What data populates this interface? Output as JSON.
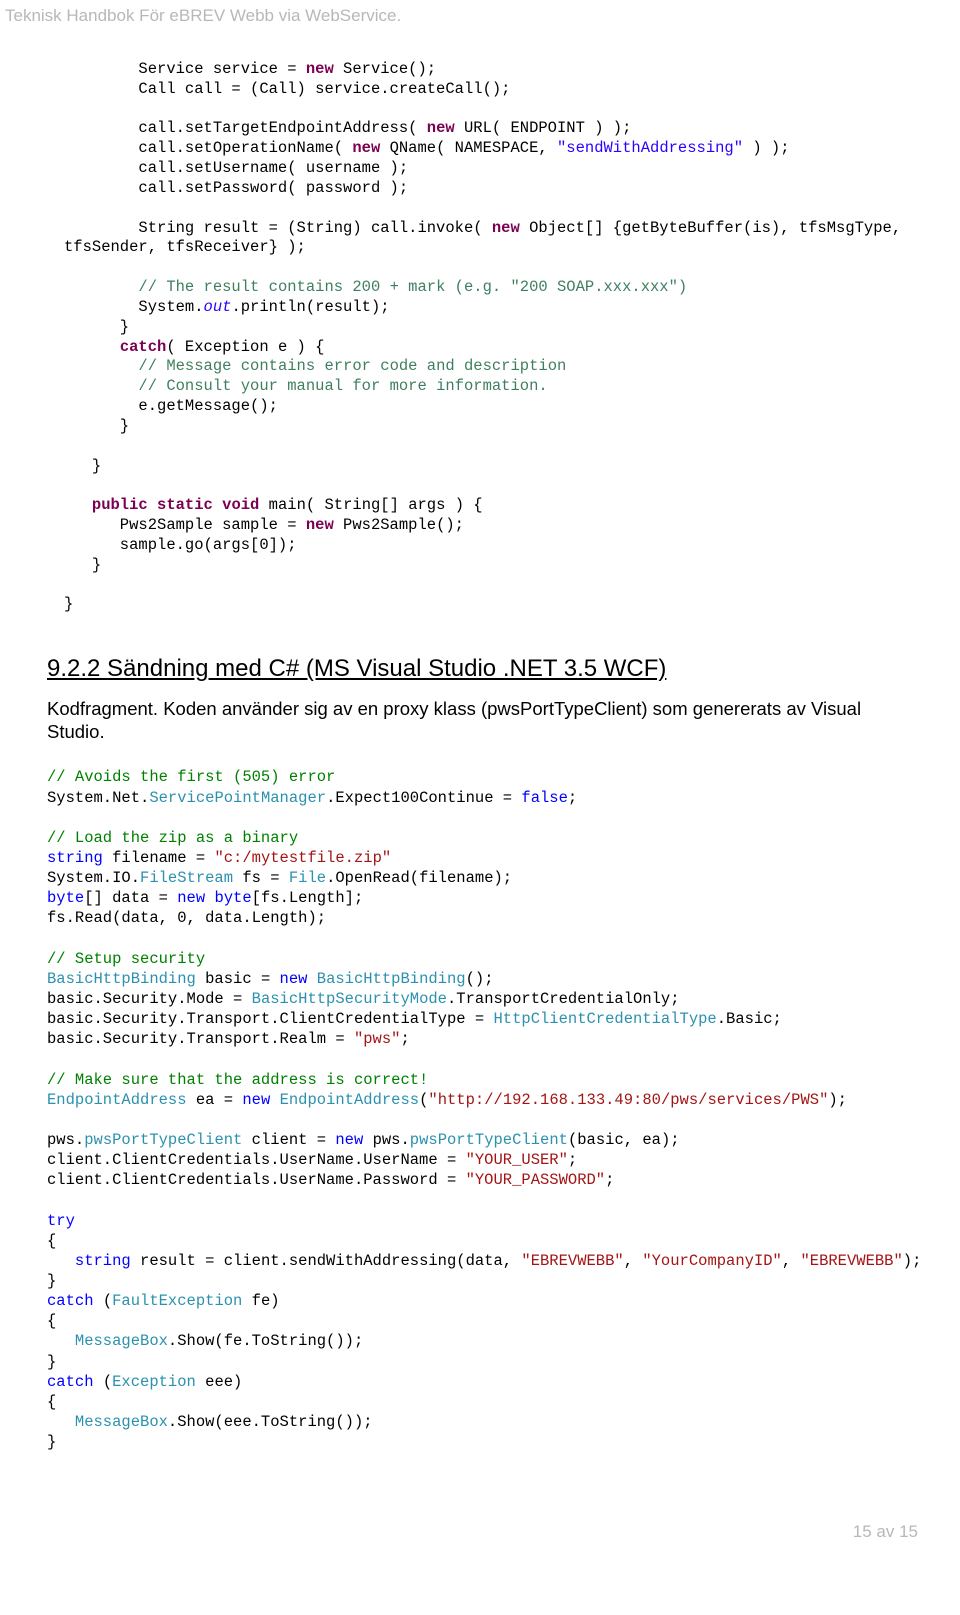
{
  "header": "Teknisk Handbok För eBREV Webb via WebService.",
  "pgno": "15 av 15",
  "java": {
    "l1a": "        Service service = ",
    "l1b": " Service();",
    "l2": "        Call call = (Call) service.createCall();",
    "l3a": "        call.setTargetEndpointAddress( ",
    "l3b": " URL( ENDPOINT ) );",
    "l4a": "        call.setOperationName( ",
    "l4b": " QName( NAMESPACE, ",
    "l4c": "\"sendWithAddressing\"",
    "l4d": " ) );",
    "l5": "        call.setUsername( username );",
    "l6": "        call.setPassword( password );",
    "l7a": "        String result = (String) call.invoke( ",
    "l7b": " Object[] {getByteBuffer(is), tfsMsgType,",
    "l7c": "tfsSender, tfsReceiver} );",
    "l8a": "        ",
    "l8b": "// The result contains 200 + mark (e.g. \"200 SOAP.xxx.xxx\")",
    "l9a": "        System.",
    "l9b": "out",
    "l9c": ".println(result);",
    "l10": "      }",
    "l11a": "      ",
    "l11b": "( Exception e ) {",
    "l12a": "        ",
    "l12b": "// Message contains error code and description",
    "l13a": "        ",
    "l13b": "// Consult your manual for more information.",
    "l14": "        e.getMessage();",
    "l15": "      }",
    "l16": "   }",
    "l17a": "   ",
    "l17b": " main( String[] args ) {",
    "l18a": "      Pws2Sample sample = ",
    "l18b": " Pws2Sample();",
    "l19": "      sample.go(args[0]);",
    "l20": "   }",
    "l21": "}",
    "kw_new": "new",
    "kw_catch": "catch",
    "kw_pub": "public",
    "kw_stat": "static",
    "kw_void": "void"
  },
  "h2": "9.2.2 Sändning med C# (MS Visual Studio .NET 3.5 WCF)",
  "para": "Kodfragment. Koden använder sig av en proxy klass (pwsPortTypeClient) som genererats av Visual Studio.",
  "cs": {
    "c1": "// Avoids the first (505) error",
    "l1a": "System.Net.",
    "l1b": "ServicePointManager",
    "l1c": ".Expect100Continue = ",
    "l1d": "false",
    "l1e": ";",
    "c2": "// Load the zip as a binary",
    "l2a": "string",
    "l2b": " filename = ",
    "l2c": "\"c:/mytestfile.zip\"",
    "l3a": "System.IO.",
    "l3b": "FileStream",
    "l3c": " fs = ",
    "l3d": "File",
    "l3e": ".OpenRead(filename);",
    "l4a": "byte",
    "l4b": "[] data = ",
    "l4c": "new",
    "l4d": " ",
    "l4e": "byte",
    "l4f": "[fs.Length];",
    "l5": "fs.Read(data, 0, data.Length);",
    "c3": "// Setup security",
    "l6a": "BasicHttpBinding",
    "l6b": " basic = ",
    "l6c": "new",
    "l6d": " ",
    "l6e": "BasicHttpBinding",
    "l6f": "();",
    "l7a": "basic.Security.Mode = ",
    "l7b": "BasicHttpSecurityMode",
    "l7c": ".TransportCredentialOnly;",
    "l8a": "basic.Security.Transport.ClientCredentialType = ",
    "l8b": "HttpClientCredentialType",
    "l8c": ".Basic;",
    "l9a": "basic.Security.Transport.Realm = ",
    "l9b": "\"pws\"",
    "l9c": ";",
    "c4": "// Make sure that the address is correct!",
    "l10a": "EndpointAddress",
    "l10b": " ea = ",
    "l10c": "new",
    "l10d": " ",
    "l10e": "EndpointAddress",
    "l10f": "(",
    "l10g": "\"http://192.168.133.49:80/pws/services/PWS\"",
    "l10h": ");",
    "l11a": "pws.",
    "l11b": "pwsPortTypeClient",
    "l11c": " client = ",
    "l11d": "new",
    "l11e": " pws.",
    "l11f": "pwsPortTypeClient",
    "l11g": "(basic, ea);",
    "l12a": "client.ClientCredentials.UserName.UserName = ",
    "l12b": "\"YOUR_USER\"",
    "l12c": ";",
    "l13a": "client.ClientCredentials.UserName.Password = ",
    "l13b": "\"YOUR_PASSWORD\"",
    "l13c": ";",
    "l14": "try",
    "l15": "{",
    "l16a": "   ",
    "l16b": "string",
    "l16c": " result = client.sendWithAddressing(data, ",
    "l16d": "\"EBREVWEBB\"",
    "l16e": ", ",
    "l16f": "\"YourCompanyID\"",
    "l16g": ", ",
    "l16h": "\"EBREVWEBB\"",
    "l16i": ");",
    "l17": "}",
    "l18a": "catch",
    "l18b": " (",
    "l18c": "FaultException",
    "l18d": " fe)",
    "l19": "{",
    "l20a": "   ",
    "l20b": "MessageBox",
    "l20c": ".Show(fe.ToString());",
    "l21": "}",
    "l22a": "catch",
    "l22b": " (",
    "l22c": "Exception",
    "l22d": " eee)",
    "l23": "{",
    "l24a": "   ",
    "l24b": "MessageBox",
    "l24c": ".Show(eee.ToString());",
    "l25": "}"
  }
}
